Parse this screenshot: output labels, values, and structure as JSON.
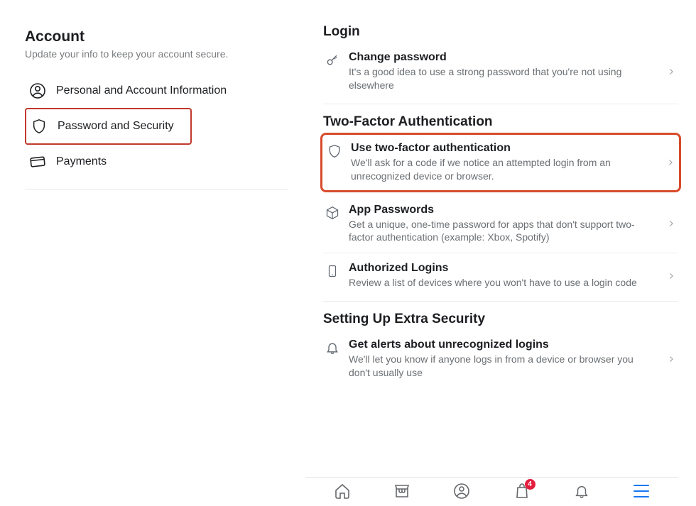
{
  "left": {
    "title": "Account",
    "subtitle": "Update your info to keep your account secure.",
    "items": [
      {
        "icon": "user-circle",
        "label": "Personal and Account Information"
      },
      {
        "icon": "shield",
        "label": "Password and Security",
        "highlighted": true
      },
      {
        "icon": "card",
        "label": "Payments"
      }
    ]
  },
  "right": {
    "sections": [
      {
        "title": "Login",
        "rows": [
          {
            "icon": "key",
            "title": "Change password",
            "desc": "It's a good idea to use a strong password that you're not using elsewhere",
            "chevron": true
          }
        ]
      },
      {
        "title": "Two-Factor Authentication",
        "rows": [
          {
            "icon": "shield",
            "title": "Use two-factor authentication",
            "desc": "We'll ask for a code if we notice an attempted login from an unrecognized device or browser.",
            "chevron": true,
            "highlighted": true
          },
          {
            "icon": "cube",
            "title": "App Passwords",
            "desc": "Get a unique, one-time password for apps that don't support two-factor authentication (example: Xbox, Spotify)",
            "chevron": true
          },
          {
            "icon": "device",
            "title": "Authorized Logins",
            "desc": "Review a list of devices where you won't have to use a login code",
            "chevron": true
          }
        ]
      },
      {
        "title": "Setting Up Extra Security",
        "rows": [
          {
            "icon": "bell",
            "title": "Get alerts about unrecognized logins",
            "desc": "We'll let you know if anyone logs in from a device or browser you don't usually use",
            "chevron": true
          }
        ]
      }
    ]
  },
  "nav": {
    "items": [
      {
        "icon": "home"
      },
      {
        "icon": "store"
      },
      {
        "icon": "user-circle"
      },
      {
        "icon": "bag",
        "badge": "4"
      },
      {
        "icon": "bell"
      },
      {
        "icon": "menu",
        "active": true
      }
    ]
  }
}
